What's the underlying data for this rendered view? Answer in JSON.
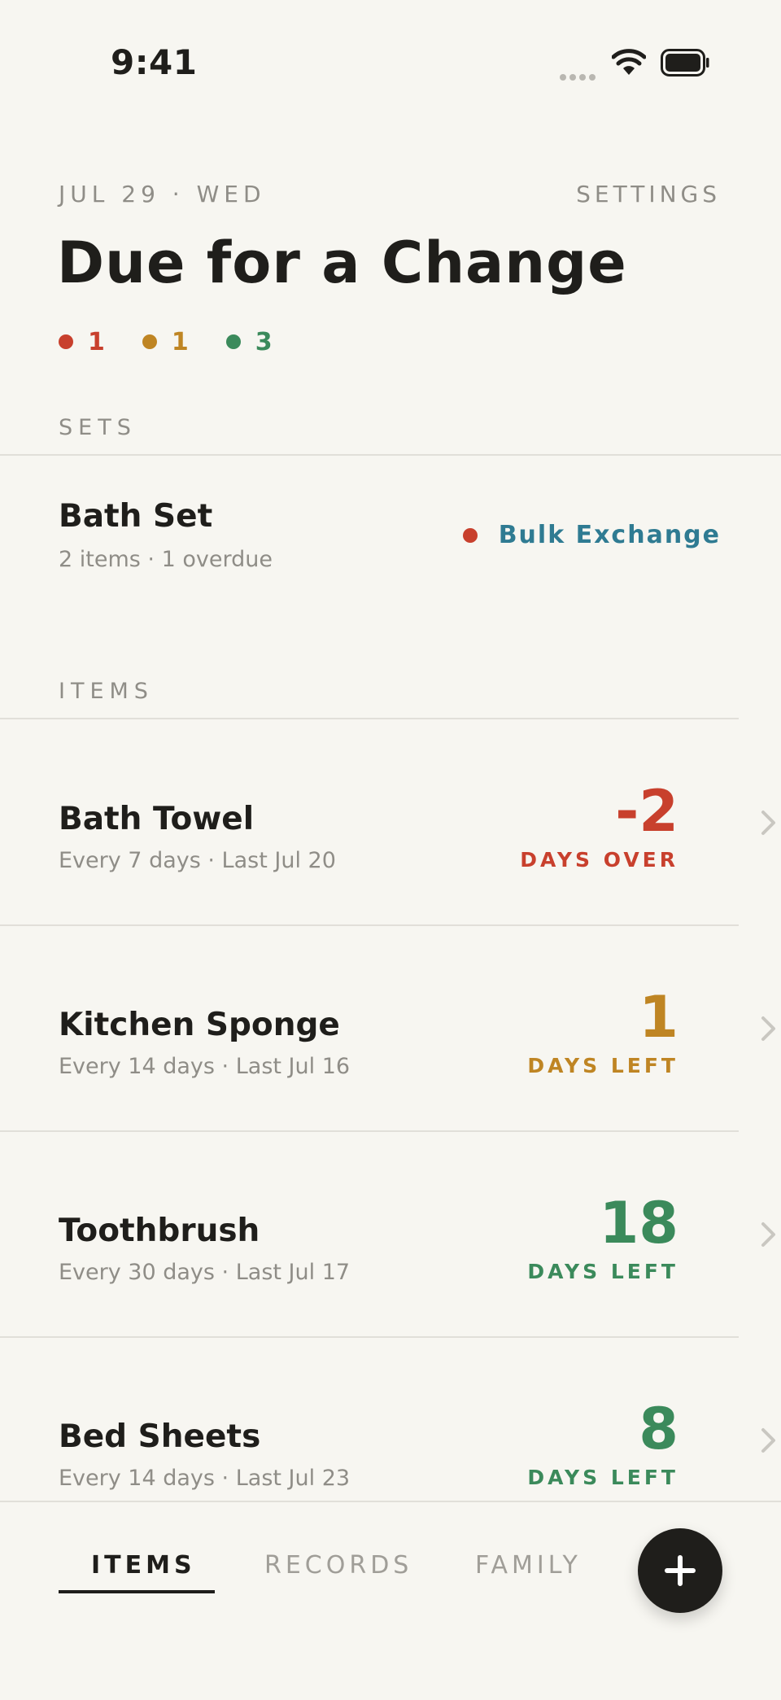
{
  "status_bar": {
    "time": "9:41"
  },
  "header": {
    "date": "JUL 29 · WED",
    "settings_label": "SETTINGS",
    "title": "Due for a Change",
    "legend": [
      {
        "count": "1",
        "color": "#c8402d"
      },
      {
        "count": "1",
        "color": "#bf8523"
      },
      {
        "count": "3",
        "color": "#3b8a5b"
      }
    ]
  },
  "sets": {
    "label": "SETS",
    "items": [
      {
        "name": "Bath Set",
        "summary": "2 items · 1 overdue",
        "action_label": "Bulk Exchange",
        "status_color": "#c8402d",
        "action_color": "#2f7b92"
      }
    ]
  },
  "items": {
    "label": "ITEMS",
    "rows": [
      {
        "name": "Bath Towel",
        "schedule": "Every 7 days · Last Jul 20",
        "days_value": "-2",
        "days_label": "DAYS OVER",
        "color": "#c8402d"
      },
      {
        "name": "Kitchen Sponge",
        "schedule": "Every 14 days · Last Jul 16",
        "days_value": "1",
        "days_label": "DAYS LEFT",
        "color": "#bf8523"
      },
      {
        "name": "Toothbrush",
        "schedule": "Every 30 days · Last Jul 17",
        "days_value": "18",
        "days_label": "DAYS LEFT",
        "color": "#3b8a5b"
      },
      {
        "name": "Bed Sheets",
        "schedule": "Every 14 days · Last Jul 23",
        "days_value": "8",
        "days_label": "DAYS LEFT",
        "color": "#3b8a5b"
      }
    ]
  },
  "tab_bar": {
    "tabs": [
      {
        "label": "ITEMS",
        "active": true
      },
      {
        "label": "RECORDS",
        "active": false
      },
      {
        "label": "FAMILY",
        "active": false
      }
    ],
    "add_icon": "plus-icon"
  },
  "theme": {
    "background": "#f7f6f1",
    "text": "#1f1e1b",
    "muted": "#8f8d87"
  }
}
